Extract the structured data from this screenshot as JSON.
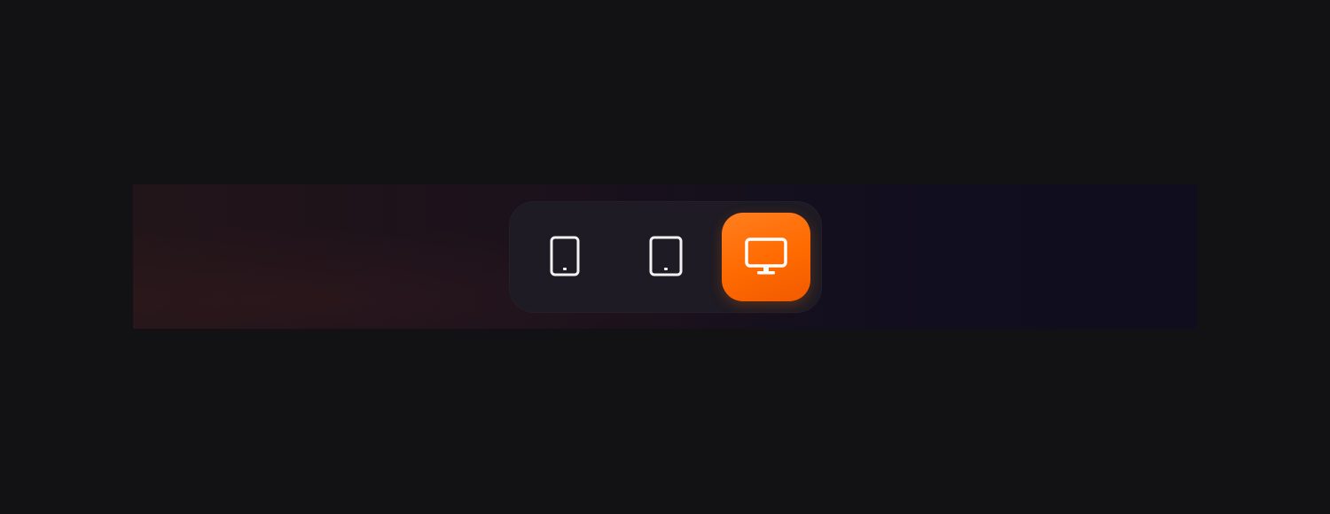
{
  "device_switcher": {
    "options": [
      {
        "id": "mobile",
        "icon": "mobile-icon",
        "selected": false
      },
      {
        "id": "tablet",
        "icon": "tablet-icon",
        "selected": false
      },
      {
        "id": "desktop",
        "icon": "monitor-icon",
        "selected": true
      }
    ],
    "colors": {
      "accent": "#ff6a00",
      "icon": "#f2f2f2",
      "pill_background": "#1e1b24",
      "page_background": "#121214"
    }
  }
}
